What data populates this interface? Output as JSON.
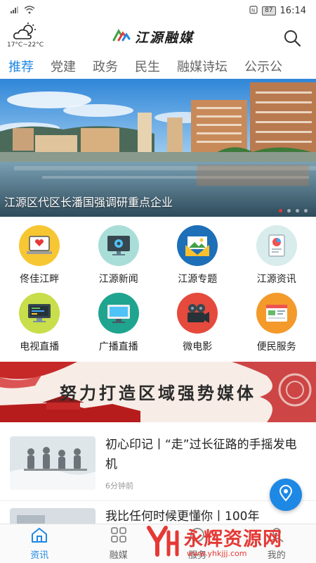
{
  "status_bar": {
    "time": "16:14",
    "battery": "87"
  },
  "header": {
    "temperature": "17°C~22°C",
    "logo_text": "江源融媒"
  },
  "tabs": [
    {
      "label": "推荐",
      "active": true
    },
    {
      "label": "党建"
    },
    {
      "label": "政务"
    },
    {
      "label": "民生"
    },
    {
      "label": "融媒诗坛"
    },
    {
      "label": "公示公"
    }
  ],
  "banner": {
    "caption": "江源区代区长潘国强调研重点企业",
    "dots": 4,
    "active_dot": 0
  },
  "grid": [
    {
      "label": "佟佳江畔",
      "icon": "laptop-heart-icon"
    },
    {
      "label": "江源新闻",
      "icon": "monitor-gear-icon"
    },
    {
      "label": "江源专题",
      "icon": "envelope-photo-icon"
    },
    {
      "label": "江源资讯",
      "icon": "document-chart-icon"
    },
    {
      "label": "电视直播",
      "icon": "desktop-tv-icon"
    },
    {
      "label": "广播直播",
      "icon": "display-monitor-icon"
    },
    {
      "label": "微电影",
      "icon": "film-camera-icon"
    },
    {
      "label": "便民服务",
      "icon": "browser-window-icon"
    }
  ],
  "slogan": {
    "text": "努力打造区域强势媒体"
  },
  "news": [
    {
      "title": "初心印记丨“走”过长征路的手摇发电机",
      "time": "6分钟前"
    },
    {
      "title": "我比任何时候更懂你丨100年",
      "time": ""
    }
  ],
  "bottom_nav": [
    {
      "label": "资讯",
      "icon": "home-icon",
      "active": true
    },
    {
      "label": "融媒",
      "icon": "grid-icon"
    },
    {
      "label": "服务",
      "icon": "service-icon"
    },
    {
      "label": "我的",
      "icon": "user-icon"
    }
  ],
  "watermark": {
    "text": "永辉资源网",
    "url": "www.yhkjjj.com"
  },
  "colors": {
    "accent": "#1e88e5",
    "red": "#e53935"
  }
}
